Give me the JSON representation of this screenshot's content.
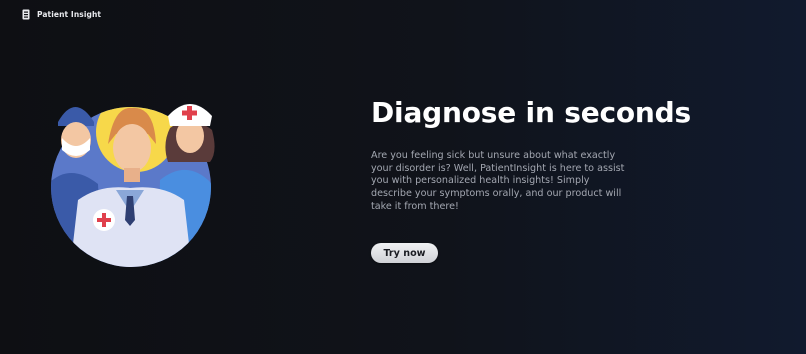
{
  "header": {
    "logo_icon": "document-icon",
    "brand": "Patient Insight"
  },
  "hero": {
    "title": "Diagnose in seconds",
    "description": "Are you feeling sick but unsure about what exactly your disorder is? Well, PatientInsight is here to assist you with personalized health insights! Simply describe your symptoms orally, and our product will take it from there!",
    "cta_label": "Try now",
    "illustration": "medical-team-illustration"
  },
  "colors": {
    "background": "#0e0f13",
    "background_right": "#111a2e",
    "circle_bg": "#5b79c9",
    "sun_yellow": "#f7d84a",
    "cross_red": "#e0404c",
    "text_primary": "#ffffff",
    "text_secondary": "#a3a7b1",
    "button_bg": "#e6e7ea"
  }
}
